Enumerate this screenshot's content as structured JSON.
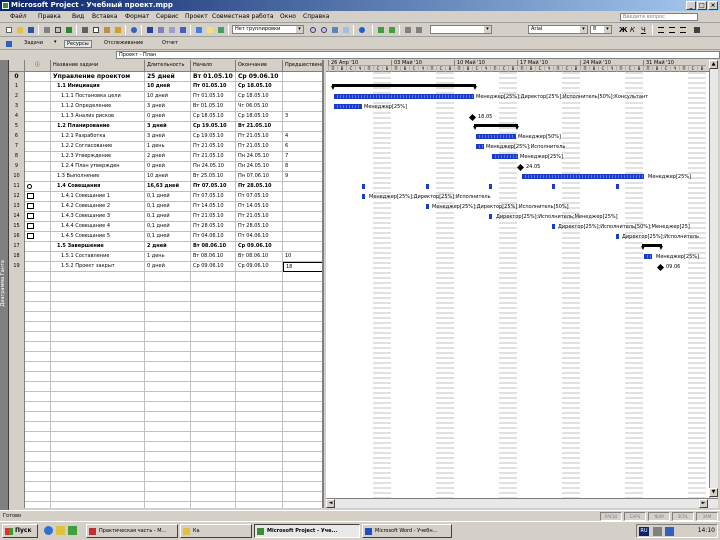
{
  "window": {
    "title": "Microsoft Project - Учебный проект.mpp"
  },
  "menu": {
    "items": [
      "Файл",
      "Правка",
      "Вид",
      "Вставка",
      "Формат",
      "Сервис",
      "Проект",
      "Совместная работа",
      "Окно",
      "Справка"
    ],
    "help_placeholder": "Введите вопрос"
  },
  "toolbar": {
    "group_combo": "Нет группировки",
    "font_combo": "Arial",
    "size_combo": "8",
    "tasks_label": "Задачи",
    "resources_label": "Ресурсы",
    "track_label": "Отслеживание",
    "report_label": "Отчет"
  },
  "edit_bar": {
    "value": "Проект - План"
  },
  "view_bar": {
    "label": "Диаграмма Ганта"
  },
  "columns": {
    "indicator": "ⓘ",
    "name": "Название задачи",
    "duration": "Длительность",
    "start": "Начало",
    "finish": "Окончание",
    "pred": "Предшественники"
  },
  "rows": [
    {
      "id": "0",
      "ind": "",
      "name": "Управление проектом",
      "dur": "25 дней",
      "start": "Вт 01.05.10",
      "finish": "Ср 09.06.10",
      "pred": ""
    },
    {
      "id": "1",
      "ind": "",
      "name": "1.1 Инициация",
      "dur": "10 дней",
      "start": "Пт 01.05.10",
      "finish": "Ср 18.05.10",
      "pred": ""
    },
    {
      "id": "2",
      "ind": "",
      "name": "1.1.1 Постановка цели",
      "dur": "10 дней",
      "start": "Пт 01.05.10",
      "finish": "Ср 18.05.10",
      "pred": ""
    },
    {
      "id": "3",
      "ind": "",
      "name": "1.1.2 Определение",
      "dur": "3 дней",
      "start": "Вт 01.05.10",
      "finish": "Чт 06.05.10",
      "pred": ""
    },
    {
      "id": "4",
      "ind": "",
      "name": "1.1.3 Анализ рисков",
      "dur": "0 дней",
      "start": "Ср 18.05.10",
      "finish": "Ср 18.05.10",
      "pred": "3"
    },
    {
      "id": "5",
      "ind": "",
      "name": "1.2 Планирование",
      "dur": "3 дней",
      "start": "Ср 19.05.10",
      "finish": "Вт 21.05.10",
      "pred": ""
    },
    {
      "id": "6",
      "ind": "",
      "name": "1.2.1 Разработка",
      "dur": "3 дней",
      "start": "Ср 19.05.10",
      "finish": "Пт 21.05.10",
      "pred": "4"
    },
    {
      "id": "7",
      "ind": "",
      "name": "1.2.2 Согласование",
      "dur": "1 день",
      "start": "Пт 21.05.10",
      "finish": "Пт 21.05.10",
      "pred": "6"
    },
    {
      "id": "8",
      "ind": "",
      "name": "1.2.3 Утверждение",
      "dur": "2 дней",
      "start": "Пт 21.05.10",
      "finish": "Пн 24.05.10",
      "pred": "7"
    },
    {
      "id": "9",
      "ind": "",
      "name": "1.2.4 План утвержден",
      "dur": "0 дней",
      "start": "Пн 24.05.10",
      "finish": "Пн 24.05.10",
      "pred": "8"
    },
    {
      "id": "10",
      "ind": "",
      "name": "1.3 Выполнение",
      "dur": "10 дней",
      "start": "Вт 25.05.10",
      "finish": "Пн 07.06.10",
      "pred": "9"
    },
    {
      "id": "11",
      "ind": "icon2",
      "name": "1.4 Совещания",
      "dur": "16,63 дней",
      "start": "Пт 07.05.10",
      "finish": "Пт 28.05.10",
      "pred": ""
    },
    {
      "id": "12",
      "ind": "icon",
      "name": "1.4.1 Совещание 1",
      "dur": "0,1 дней",
      "start": "Пт 07.05.10",
      "finish": "Пт 07.05.10",
      "pred": ""
    },
    {
      "id": "13",
      "ind": "icon",
      "name": "1.4.2 Совещание 2",
      "dur": "0,1 дней",
      "start": "Пт 14.05.10",
      "finish": "Пт 14.05.10",
      "pred": ""
    },
    {
      "id": "14",
      "ind": "icon",
      "name": "1.4.3 Совещание 3",
      "dur": "0,1 дней",
      "start": "Пт 21.05.10",
      "finish": "Пт 21.05.10",
      "pred": ""
    },
    {
      "id": "15",
      "ind": "icon",
      "name": "1.4.4 Совещание 4",
      "dur": "0,1 дней",
      "start": "Пт 28.05.10",
      "finish": "Пт 28.05.10",
      "pred": ""
    },
    {
      "id": "16",
      "ind": "icon",
      "name": "1.4.5 Совещание 5",
      "dur": "0,1 дней",
      "start": "Пт 04.06.10",
      "finish": "Пт 04.06.10",
      "pred": ""
    },
    {
      "id": "17",
      "ind": "",
      "name": "1.5 Завершение",
      "dur": "2 дней",
      "start": "Вт 08.06.10",
      "finish": "Ср 09.06.10",
      "pred": ""
    },
    {
      "id": "18",
      "ind": "",
      "name": "1.5.1 Составление",
      "dur": "1 день",
      "start": "Вт 08.06.10",
      "finish": "Вт 08.06.10",
      "pred": "10"
    },
    {
      "id": "19",
      "ind": "",
      "name": "1.5.2 Проект закрыт",
      "dur": "0 дней",
      "start": "Ср 09.06.10",
      "finish": "Ср 09.06.10",
      "pred": "18"
    }
  ],
  "gantt": {
    "weeks": [
      "26 Апр '10",
      "03 Май '10",
      "10 Май '10",
      "17 Май '10",
      "24 Май '10",
      "31 Май '10"
    ],
    "days": [
      "П",
      "В",
      "С",
      "Ч",
      "П",
      "С",
      "В"
    ],
    "labels": {
      "r2": "Менеджер[25%];Директор[25%];Исполнитель[50%];Консультант",
      "r3": "Менеджер[25%]",
      "r4": "18.05",
      "r6": "Менеджер[50%]",
      "r7": "Менеджер[25%];Исполнитель",
      "r8": "Менеджер[25%]",
      "r9": "24.05",
      "r10": "Менеджер[25%]",
      "r12": "Менеджер[25%];Директор[25%];Исполнитель",
      "r13": "Менеджер[25%];Директор[25%];Исполнитель[50%]",
      "r14": "Директор[25%];Исполнитель;Менеджер[25%]",
      "r15": "Директор[25%];Исполнитель[50%];Менеджер[25]",
      "r16": "Директор[25%];Исполнитель",
      "r18": "Менеджер[25%]",
      "r19": "09.06"
    }
  },
  "status": {
    "text": "Готово",
    "cells": [
      "РАСШ",
      "CAPS",
      "NUM",
      "SCRL",
      "ЗАМ"
    ]
  },
  "taskbar": {
    "start": "Пуск",
    "tasks": [
      "Практическая часть - М...",
      "Ка",
      "Microsoft Project - Уче...",
      "Microsoft Word - Учебн..."
    ],
    "lang": "RU",
    "clock": "14:10"
  }
}
